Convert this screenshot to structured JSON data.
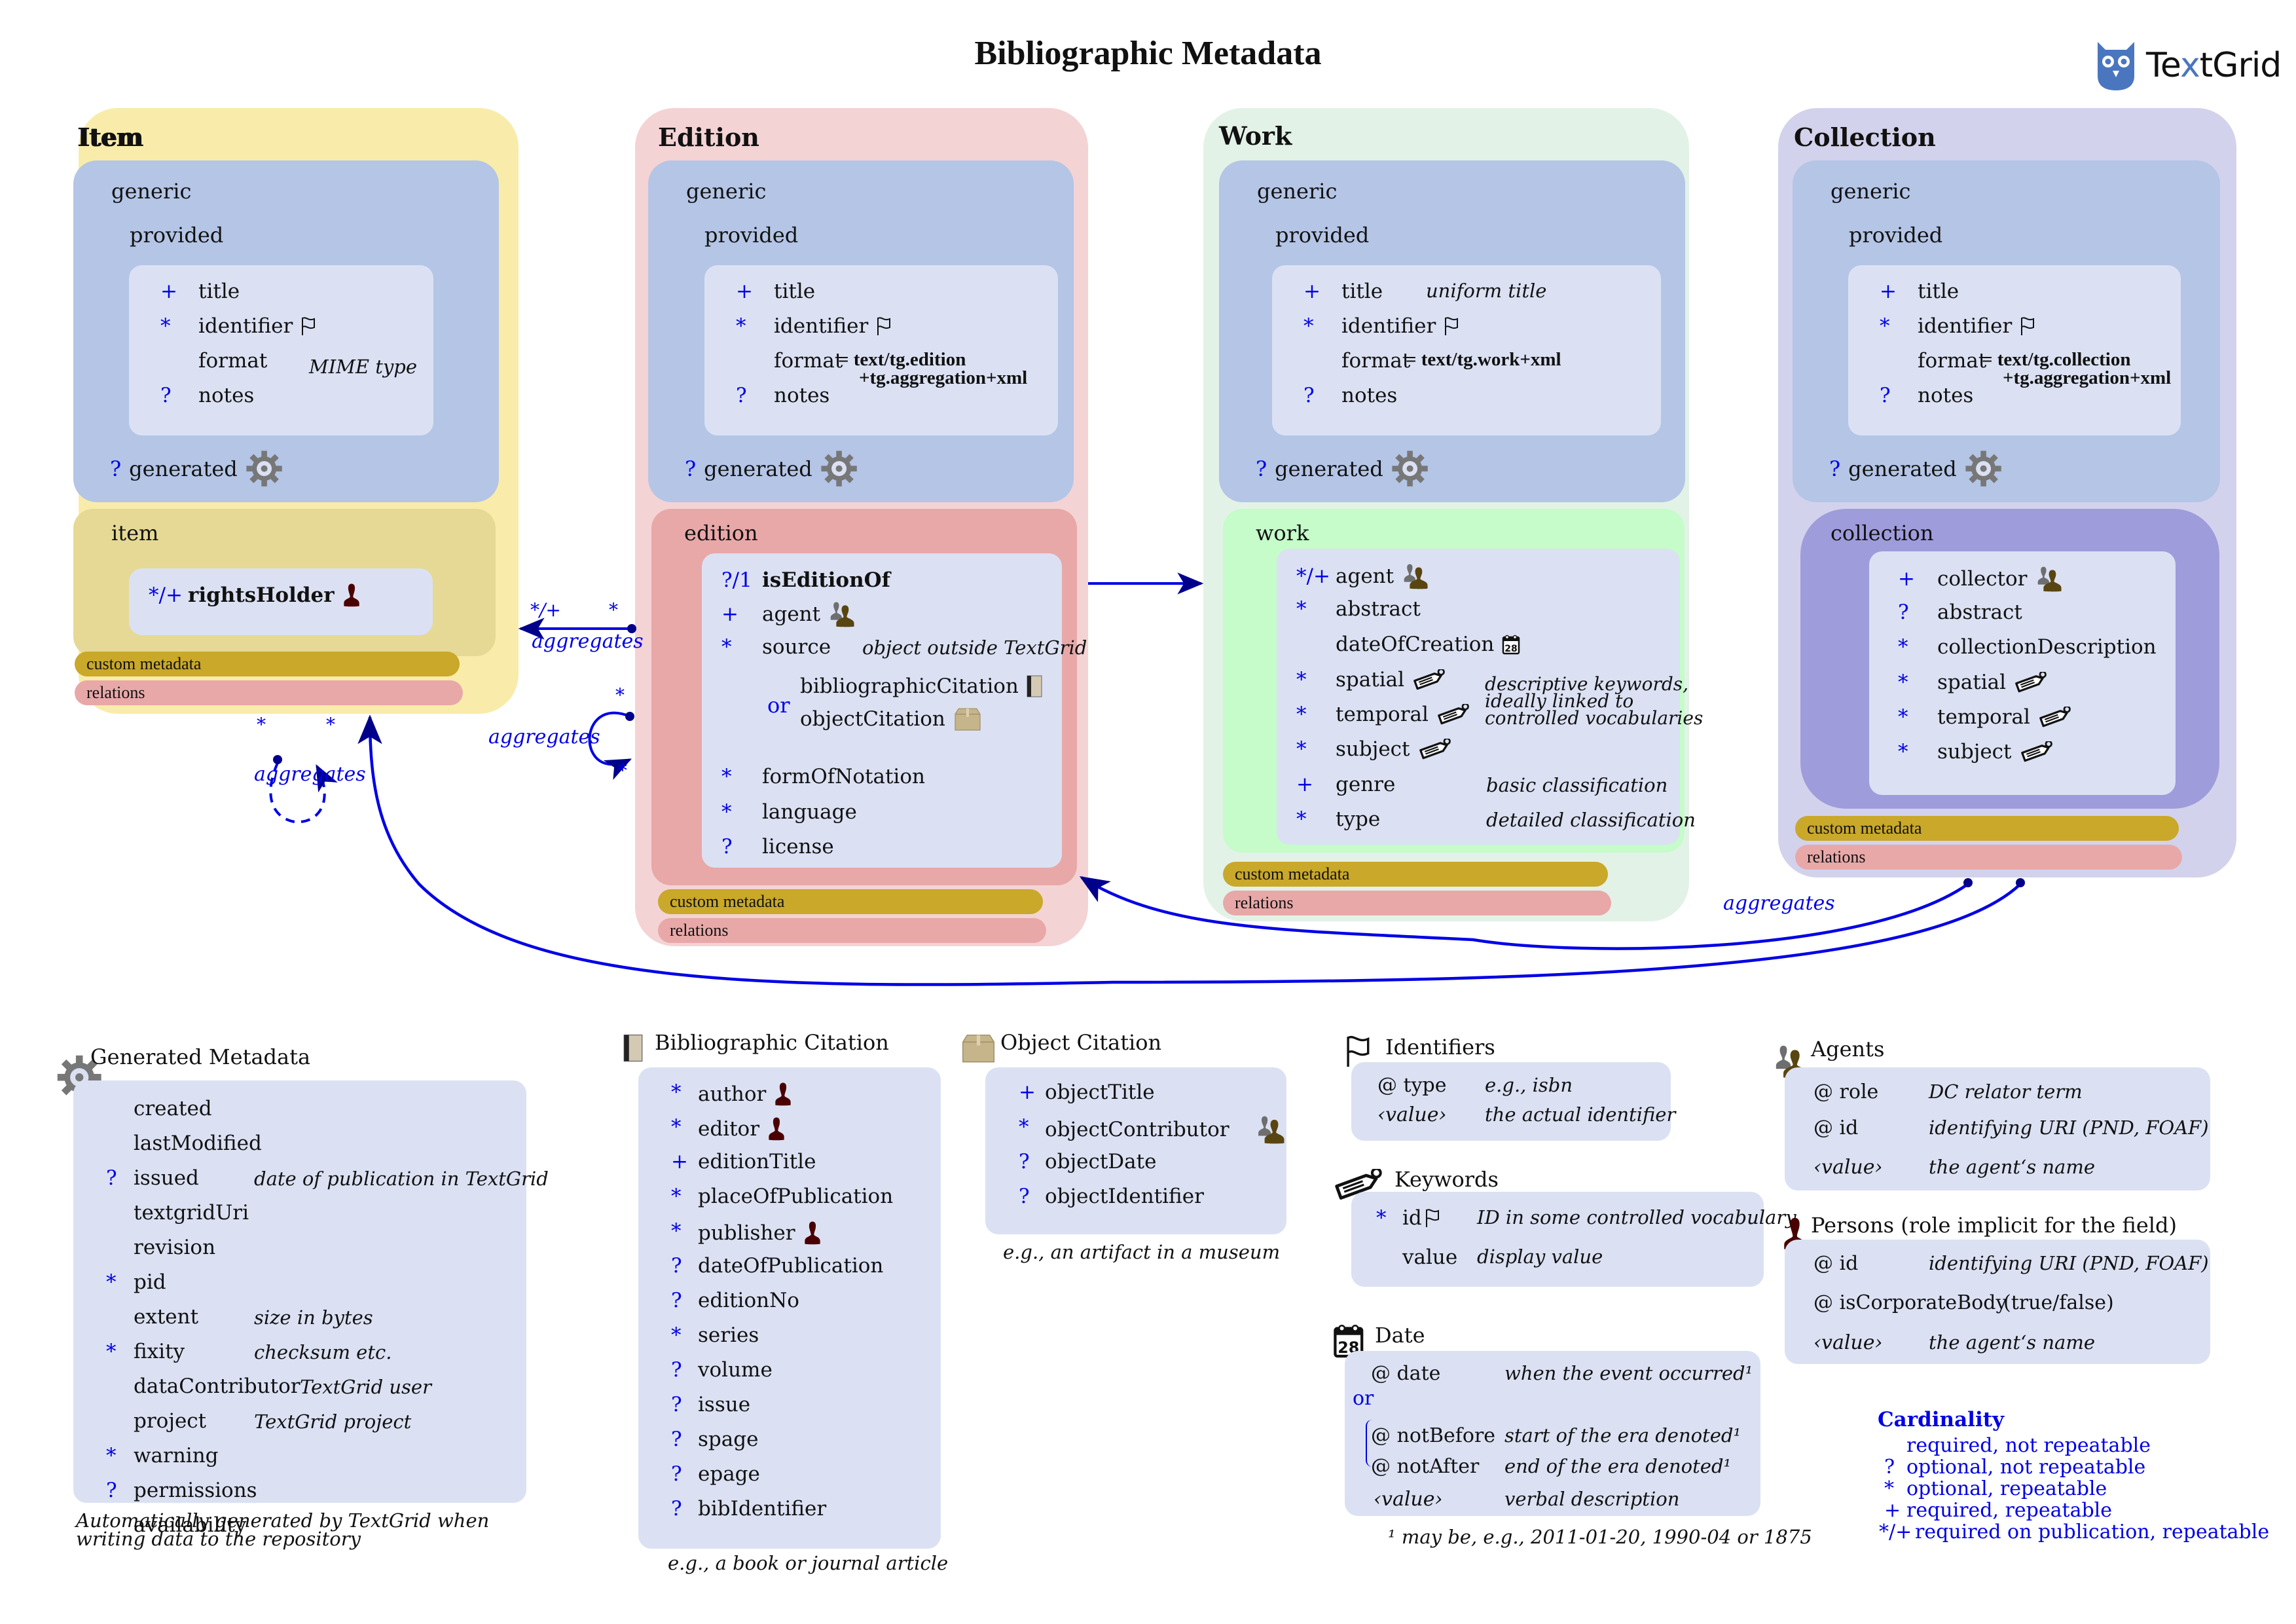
{
  "header": {
    "title": "Bibliographic Metadata",
    "logo_text_a": "Te",
    "logo_text_x": "x",
    "logo_text_b": "tGrid"
  },
  "colors": {
    "cardinality_blue": "#0000e6",
    "arrow_blue": "#0000cc",
    "item_bg": "#f9ecaa",
    "item_panel": "#e5d995",
    "edition_bg": "#f4d3d5",
    "edition_panel": "#e8a8a8",
    "work_bg": "#e3f2e7",
    "work_panel": "#c5fcc9",
    "collection_bg": "#d3d2ec",
    "collection_panel": "#9f9cdb",
    "generic_panel": "#b4c5e6",
    "inner_box": "#dbe1f3",
    "custom_metadata": "#c9a82a",
    "relations": "#e8a8a8",
    "logo_blue": "#4a76bf"
  },
  "shared": {
    "generic": "generic",
    "provided": "provided",
    "generated": "generated",
    "generated_sym": "?",
    "custom_metadata": "custom metadata",
    "relations": "relations",
    "or": "or"
  },
  "item": {
    "title": "Item",
    "provided": [
      {
        "sym": "+",
        "name": "title"
      },
      {
        "sym": "*",
        "name": "identifier",
        "icon": "flag-icon"
      },
      {
        "sym": "",
        "name": "format",
        "note": "MIME type"
      },
      {
        "sym": "?",
        "name": "notes"
      }
    ],
    "section": "item",
    "fields": [
      {
        "sym": "*/+",
        "name": "rightsHolder",
        "icon": "person-icon",
        "bold": true
      }
    ]
  },
  "edition": {
    "title": "Edition",
    "provided": [
      {
        "sym": "+",
        "name": "title"
      },
      {
        "sym": "*",
        "name": "identifier",
        "icon": "flag-icon"
      },
      {
        "sym": "",
        "name": "format",
        "value": "= text/tg.edition",
        "value2": "+tg.aggregation+xml"
      },
      {
        "sym": "?",
        "name": "notes"
      }
    ],
    "section": "edition",
    "fields": [
      {
        "sym": "?/1",
        "name": "isEditionOf",
        "bold": true
      },
      {
        "sym": "+",
        "name": "agent",
        "icon": "agents-icon"
      },
      {
        "sym": "*",
        "name": "source",
        "note": "object outside TextGrid"
      },
      {
        "sym": "",
        "name": "bibliographicCitation",
        "icon": "book-icon"
      },
      {
        "sym": "",
        "name": "objectCitation",
        "icon": "box-icon"
      },
      {
        "sym": "*",
        "name": "formOfNotation"
      },
      {
        "sym": "*",
        "name": "language"
      },
      {
        "sym": "?",
        "name": "license"
      }
    ]
  },
  "work": {
    "title": "Work",
    "provided": [
      {
        "sym": "+",
        "name": "title",
        "note": "uniform title"
      },
      {
        "sym": "*",
        "name": "identifier",
        "icon": "flag-icon"
      },
      {
        "sym": "",
        "name": "format",
        "value": "= text/tg.work+xml"
      },
      {
        "sym": "?",
        "name": "notes"
      }
    ],
    "section": "work",
    "fields": [
      {
        "sym": "*/+",
        "name": "agent",
        "icon": "agents-icon"
      },
      {
        "sym": "*",
        "name": "abstract"
      },
      {
        "sym": "",
        "name": "dateOfCreation",
        "icon": "calendar-icon"
      },
      {
        "sym": "*",
        "name": "spatial",
        "icon": "tag-icon"
      },
      {
        "sym": "*",
        "name": "temporal",
        "icon": "tag-icon"
      },
      {
        "sym": "*",
        "name": "subject",
        "icon": "tag-icon"
      },
      {
        "sym": "+",
        "name": "genre",
        "note": "basic classification"
      },
      {
        "sym": "*",
        "name": "type",
        "note": "detailed classification"
      }
    ],
    "keywords_note_1": "descriptive keywords,",
    "keywords_note_2": "ideally linked to",
    "keywords_note_3": "controlled vocabularies"
  },
  "collection": {
    "title": "Collection",
    "provided": [
      {
        "sym": "+",
        "name": "title"
      },
      {
        "sym": "*",
        "name": "identifier",
        "icon": "flag-icon"
      },
      {
        "sym": "",
        "name": "format",
        "value": "= text/tg.collection",
        "value2": "+tg.aggregation+xml"
      },
      {
        "sym": "?",
        "name": "notes"
      }
    ],
    "section": "collection",
    "fields": [
      {
        "sym": "+",
        "name": "collector",
        "icon": "agents-icon"
      },
      {
        "sym": "?",
        "name": "abstract"
      },
      {
        "sym": "*",
        "name": "collectionDescription"
      },
      {
        "sym": "*",
        "name": "spatial",
        "icon": "tag-icon"
      },
      {
        "sym": "*",
        "name": "temporal",
        "icon": "tag-icon"
      },
      {
        "sym": "*",
        "name": "subject",
        "icon": "tag-icon"
      }
    ]
  },
  "relations": {
    "edition_to_item": {
      "label": "aggregates",
      "source_card": "*",
      "target_card": "*/+"
    },
    "edition_self": {
      "label": "aggregates",
      "start_card": "*",
      "end_card": "*"
    },
    "item_self": {
      "label": "aggregates",
      "start_card": "*",
      "end_card": "*"
    },
    "collection_to_edition": {
      "label": "aggregates"
    }
  },
  "legends": {
    "generated": {
      "title": "Generated Metadata",
      "rows": [
        {
          "sym": "",
          "name": "created"
        },
        {
          "sym": "",
          "name": "lastModified"
        },
        {
          "sym": "?",
          "name": "issued",
          "note": "date of publication in TextGrid"
        },
        {
          "sym": "",
          "name": "textgridUri"
        },
        {
          "sym": "",
          "name": "revision"
        },
        {
          "sym": "*",
          "name": "pid"
        },
        {
          "sym": "",
          "name": "extent",
          "note": "size in bytes"
        },
        {
          "sym": "*",
          "name": "fixity",
          "note": "checksum etc."
        },
        {
          "sym": "",
          "name": "dataContributor",
          "note": "TextGrid user"
        },
        {
          "sym": "",
          "name": "project",
          "note": "TextGrid project"
        },
        {
          "sym": "*",
          "name": "warning"
        },
        {
          "sym": "?",
          "name": "permissions"
        },
        {
          "sym": "",
          "name": "availability"
        }
      ],
      "caption": "Automatically generated by TextGrid when writing data to the repository"
    },
    "bibliographic": {
      "title": "Bibliographic Citation",
      "rows": [
        {
          "sym": "*",
          "name": "author",
          "icon": "person-icon"
        },
        {
          "sym": "*",
          "name": "editor",
          "icon": "person-icon"
        },
        {
          "sym": "+",
          "name": "editionTitle"
        },
        {
          "sym": "*",
          "name": "placeOfPublication"
        },
        {
          "sym": "*",
          "name": "publisher",
          "icon": "person-icon"
        },
        {
          "sym": "?",
          "name": "dateOfPublication"
        },
        {
          "sym": "?",
          "name": "editionNo"
        },
        {
          "sym": "*",
          "name": "series"
        },
        {
          "sym": "?",
          "name": "volume"
        },
        {
          "sym": "?",
          "name": "issue"
        },
        {
          "sym": "?",
          "name": "spage"
        },
        {
          "sym": "?",
          "name": "epage"
        },
        {
          "sym": "?",
          "name": "bibIdentifier"
        }
      ],
      "caption": "e.g., a book or journal article"
    },
    "object": {
      "title": "Object Citation",
      "rows": [
        {
          "sym": "+",
          "name": "objectTitle"
        },
        {
          "sym": "*",
          "name": "objectContributor",
          "icon": "agents-icon"
        },
        {
          "sym": "?",
          "name": "objectDate"
        },
        {
          "sym": "?",
          "name": "objectIdentifier"
        }
      ],
      "caption": "e.g., an artifact in a museum"
    },
    "identifiers": {
      "title": "Identifiers",
      "rows": [
        {
          "key": "@ type",
          "note": "e.g., isbn"
        },
        {
          "key": "‹value›",
          "note": "the actual identifier",
          "key_italic": true
        }
      ]
    },
    "keywords": {
      "title": "Keywords",
      "rows": [
        {
          "sym": "*",
          "key": "id",
          "icon": "flag-icon",
          "note": "ID in some controlled vocabulary"
        },
        {
          "sym": "",
          "key": "value",
          "note": "display value"
        }
      ]
    },
    "date": {
      "title": "Date",
      "rows": [
        {
          "key": "@ date",
          "note": "when the event occurred¹"
        },
        {
          "key": "@ notBefore",
          "note": "start of the era denoted¹"
        },
        {
          "key": "@ notAfter",
          "note": "end of the era denoted¹"
        },
        {
          "key": "‹value›",
          "note": "verbal description",
          "key_italic": true
        }
      ],
      "or": "or",
      "footnote": "¹ may be, e.g., 2011-01-20, 1990-04 or 1875"
    },
    "agents": {
      "title": "Agents",
      "rows": [
        {
          "key": "@ role",
          "note": "DC relator term"
        },
        {
          "key": "@ id",
          "note": "identifying URI (PND, FOAF)"
        },
        {
          "key": "‹value›",
          "note": "the agent‘s name",
          "key_italic": true
        }
      ]
    },
    "persons": {
      "title": "Persons (role implicit for the field)",
      "rows": [
        {
          "key": "@ id",
          "note": "identifying URI (PND, FOAF)"
        },
        {
          "key": "@ isCorporateBody",
          "note_plain": "(true/false)"
        },
        {
          "key": "‹value›",
          "note": "the agent‘s name",
          "key_italic": true
        }
      ]
    },
    "cardinality": {
      "title": "Cardinality",
      "rows": [
        {
          "sym": "",
          "text": "required, not repeatable"
        },
        {
          "sym": "?",
          "text": "optional, not repeatable"
        },
        {
          "sym": "*",
          "text": "optional, repeatable"
        },
        {
          "sym": "+",
          "text": "required, repeatable"
        },
        {
          "sym": "*/+",
          "text": "required on publication, repeatable"
        }
      ]
    }
  }
}
